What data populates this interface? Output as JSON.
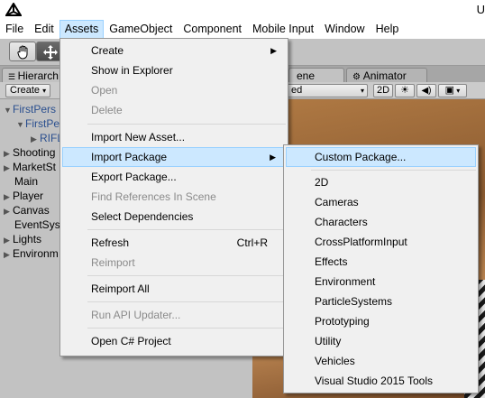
{
  "window": {
    "title": "U"
  },
  "menubar": {
    "items": [
      "File",
      "Edit",
      "Assets",
      "GameObject",
      "Component",
      "Mobile Input",
      "Window",
      "Help"
    ]
  },
  "tabs": {
    "hierarchy": "Hierarch",
    "scene": "ene",
    "animator": "Animator"
  },
  "hierarchy": {
    "create_label": "Create",
    "items": [
      {
        "label": "FirstPers",
        "level": 0,
        "blue": true
      },
      {
        "label": "FirstPer",
        "level": 1,
        "blue": true
      },
      {
        "label": "RIFL",
        "level": 2,
        "blue": true
      },
      {
        "label": "Shooting",
        "level": 0,
        "blue": false
      },
      {
        "label": "MarketSt",
        "level": 0,
        "blue": false
      },
      {
        "label": "Main",
        "level": 0,
        "blue": false
      },
      {
        "label": "Player",
        "level": 0,
        "blue": false
      },
      {
        "label": "Canvas",
        "level": 0,
        "blue": false
      },
      {
        "label": "EventSys",
        "level": 0,
        "blue": false
      },
      {
        "label": "Lights",
        "level": 0,
        "blue": false
      },
      {
        "label": "Environm",
        "level": 0,
        "blue": false
      }
    ]
  },
  "scene_toolbar": {
    "shading": "ed",
    "mode_2d": "2D"
  },
  "assets_menu": {
    "items": [
      {
        "label": "Create",
        "submenu": true,
        "enabled": true
      },
      {
        "label": "Show in Explorer",
        "enabled": true
      },
      {
        "label": "Open",
        "enabled": false
      },
      {
        "label": "Delete",
        "enabled": false
      },
      {
        "label": "Import New Asset...",
        "enabled": true
      },
      {
        "label": "Import Package",
        "submenu": true,
        "enabled": true,
        "highlighted": true
      },
      {
        "label": "Export Package...",
        "enabled": true
      },
      {
        "label": "Find References In Scene",
        "enabled": false
      },
      {
        "label": "Select Dependencies",
        "enabled": true
      },
      {
        "label": "Refresh",
        "shortcut": "Ctrl+R",
        "enabled": true
      },
      {
        "label": "Reimport",
        "enabled": false
      },
      {
        "label": "Reimport All",
        "enabled": true
      },
      {
        "label": "Run API Updater...",
        "enabled": false
      },
      {
        "label": "Open C# Project",
        "enabled": true
      }
    ]
  },
  "import_package_menu": {
    "items": [
      {
        "label": "Custom Package...",
        "highlighted": true
      },
      {
        "label": "2D"
      },
      {
        "label": "Cameras"
      },
      {
        "label": "Characters"
      },
      {
        "label": "CrossPlatformInput"
      },
      {
        "label": "Effects"
      },
      {
        "label": "Environment"
      },
      {
        "label": "ParticleSystems"
      },
      {
        "label": "Prototyping"
      },
      {
        "label": "Utility"
      },
      {
        "label": "Vehicles"
      },
      {
        "label": "Visual Studio 2015 Tools"
      }
    ]
  },
  "colors": {
    "highlight": "#cce8ff",
    "highlight_border": "#99d1ff",
    "menu_bg": "#f0f0f0",
    "panel_bg": "#c2c2c2",
    "disabled_text": "#8a8a8a"
  }
}
